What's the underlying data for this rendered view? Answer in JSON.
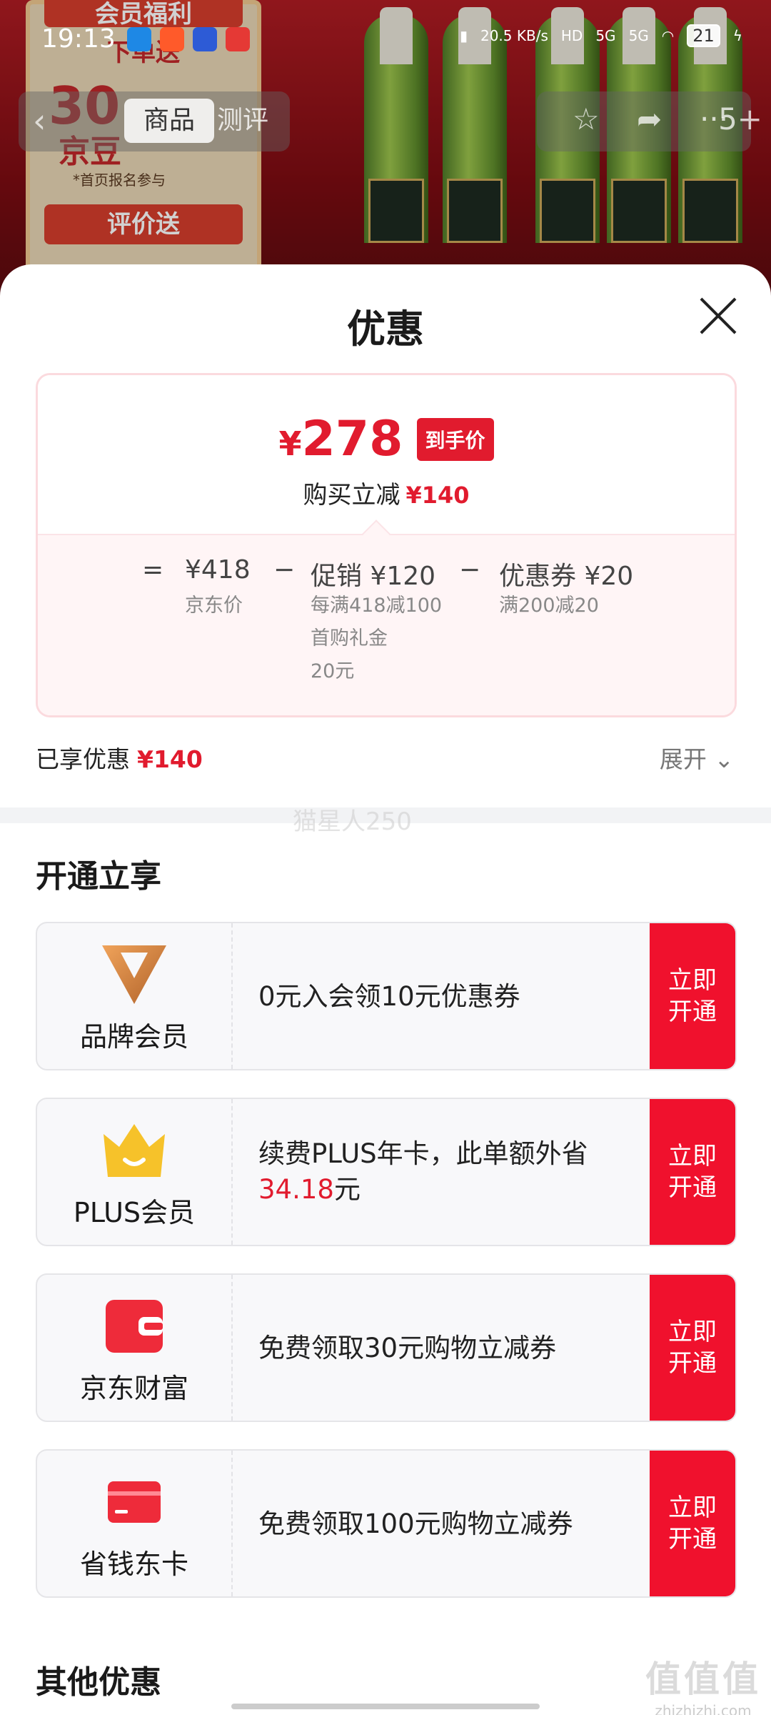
{
  "status_bar": {
    "time": "19:13",
    "net_speed": "20.5 KB/s",
    "signal1": "5G",
    "signal2": "5G",
    "battery": "21"
  },
  "product_nav": {
    "tab_goods": "商品",
    "tab_review": "测评",
    "more_badge": "5+"
  },
  "poster": {
    "line1": "会员福利",
    "line2": "下单送",
    "big": "30",
    "unit": "京豆",
    "note": "*首页报名参与",
    "line3": "评价送"
  },
  "sheet": {
    "title": "优惠",
    "final_price_symbol": "¥",
    "final_price": "278",
    "final_tag": "到手价",
    "save_label": "购买立减",
    "save_amount": "¥140",
    "breakdown": {
      "eq": "=",
      "base_price": "¥418",
      "base_label": "京东价",
      "minus1": "−",
      "promo_label": "促销 ¥120",
      "promo_sub1": "每满418减100",
      "promo_sub2": "首购礼金",
      "promo_sub3": "20元",
      "minus2": "−",
      "coupon_label": "优惠券 ¥20",
      "coupon_sub": "满200减20"
    },
    "enjoyed_label": "已享优惠",
    "enjoyed_amount": "¥140",
    "expand_label": "展开",
    "watermark": "猫星人250",
    "section_open": "开通立享",
    "offers": [
      {
        "name": "品牌会员",
        "desc": "0元入会领10元优惠券",
        "desc_red": "",
        "desc_tail": "",
        "cta": "立即开通",
        "icon": "brand-v-icon"
      },
      {
        "name": "PLUS会员",
        "desc": "续费PLUS年卡，此单额外省",
        "desc_red": "34.18",
        "desc_tail": "元",
        "cta": "立即开通",
        "icon": "crown-icon"
      },
      {
        "name": "京东财富",
        "desc": "免费领取30元购物立减券",
        "desc_red": "",
        "desc_tail": "",
        "cta": "立即开通",
        "icon": "wallet-icon"
      },
      {
        "name": "省钱东卡",
        "desc": "免费领取100元购物立减券",
        "desc_red": "",
        "desc_tail": "",
        "cta": "立即开通",
        "icon": "card-icon"
      }
    ],
    "section_other": "其他优惠"
  },
  "corner_watermark": {
    "logo": "值值值",
    "url": "zhizhizhi.com"
  },
  "colors": {
    "accent_red": "#e11b2e",
    "cta_red": "#f0112d",
    "gold": "#f6c22a"
  }
}
